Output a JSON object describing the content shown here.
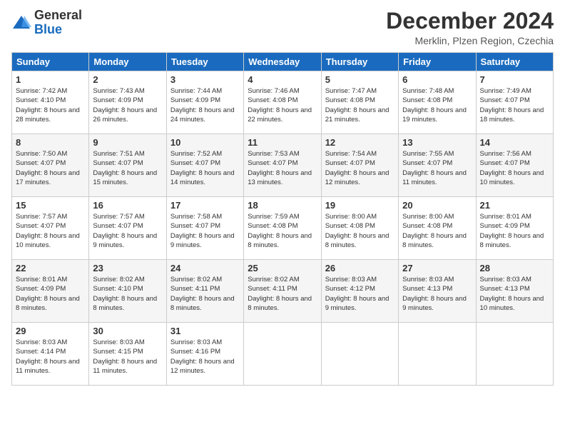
{
  "header": {
    "logo": {
      "line1": "General",
      "line2": "Blue"
    },
    "title": "December 2024",
    "location": "Merklin, Plzen Region, Czechia"
  },
  "weekdays": [
    "Sunday",
    "Monday",
    "Tuesday",
    "Wednesday",
    "Thursday",
    "Friday",
    "Saturday"
  ],
  "weeks": [
    [
      {
        "day": "1",
        "sunrise": "Sunrise: 7:42 AM",
        "sunset": "Sunset: 4:10 PM",
        "daylight": "Daylight: 8 hours and 28 minutes."
      },
      {
        "day": "2",
        "sunrise": "Sunrise: 7:43 AM",
        "sunset": "Sunset: 4:09 PM",
        "daylight": "Daylight: 8 hours and 26 minutes."
      },
      {
        "day": "3",
        "sunrise": "Sunrise: 7:44 AM",
        "sunset": "Sunset: 4:09 PM",
        "daylight": "Daylight: 8 hours and 24 minutes."
      },
      {
        "day": "4",
        "sunrise": "Sunrise: 7:46 AM",
        "sunset": "Sunset: 4:08 PM",
        "daylight": "Daylight: 8 hours and 22 minutes."
      },
      {
        "day": "5",
        "sunrise": "Sunrise: 7:47 AM",
        "sunset": "Sunset: 4:08 PM",
        "daylight": "Daylight: 8 hours and 21 minutes."
      },
      {
        "day": "6",
        "sunrise": "Sunrise: 7:48 AM",
        "sunset": "Sunset: 4:08 PM",
        "daylight": "Daylight: 8 hours and 19 minutes."
      },
      {
        "day": "7",
        "sunrise": "Sunrise: 7:49 AM",
        "sunset": "Sunset: 4:07 PM",
        "daylight": "Daylight: 8 hours and 18 minutes."
      }
    ],
    [
      {
        "day": "8",
        "sunrise": "Sunrise: 7:50 AM",
        "sunset": "Sunset: 4:07 PM",
        "daylight": "Daylight: 8 hours and 17 minutes."
      },
      {
        "day": "9",
        "sunrise": "Sunrise: 7:51 AM",
        "sunset": "Sunset: 4:07 PM",
        "daylight": "Daylight: 8 hours and 15 minutes."
      },
      {
        "day": "10",
        "sunrise": "Sunrise: 7:52 AM",
        "sunset": "Sunset: 4:07 PM",
        "daylight": "Daylight: 8 hours and 14 minutes."
      },
      {
        "day": "11",
        "sunrise": "Sunrise: 7:53 AM",
        "sunset": "Sunset: 4:07 PM",
        "daylight": "Daylight: 8 hours and 13 minutes."
      },
      {
        "day": "12",
        "sunrise": "Sunrise: 7:54 AM",
        "sunset": "Sunset: 4:07 PM",
        "daylight": "Daylight: 8 hours and 12 minutes."
      },
      {
        "day": "13",
        "sunrise": "Sunrise: 7:55 AM",
        "sunset": "Sunset: 4:07 PM",
        "daylight": "Daylight: 8 hours and 11 minutes."
      },
      {
        "day": "14",
        "sunrise": "Sunrise: 7:56 AM",
        "sunset": "Sunset: 4:07 PM",
        "daylight": "Daylight: 8 hours and 10 minutes."
      }
    ],
    [
      {
        "day": "15",
        "sunrise": "Sunrise: 7:57 AM",
        "sunset": "Sunset: 4:07 PM",
        "daylight": "Daylight: 8 hours and 10 minutes."
      },
      {
        "day": "16",
        "sunrise": "Sunrise: 7:57 AM",
        "sunset": "Sunset: 4:07 PM",
        "daylight": "Daylight: 8 hours and 9 minutes."
      },
      {
        "day": "17",
        "sunrise": "Sunrise: 7:58 AM",
        "sunset": "Sunset: 4:07 PM",
        "daylight": "Daylight: 8 hours and 9 minutes."
      },
      {
        "day": "18",
        "sunrise": "Sunrise: 7:59 AM",
        "sunset": "Sunset: 4:08 PM",
        "daylight": "Daylight: 8 hours and 8 minutes."
      },
      {
        "day": "19",
        "sunrise": "Sunrise: 8:00 AM",
        "sunset": "Sunset: 4:08 PM",
        "daylight": "Daylight: 8 hours and 8 minutes."
      },
      {
        "day": "20",
        "sunrise": "Sunrise: 8:00 AM",
        "sunset": "Sunset: 4:08 PM",
        "daylight": "Daylight: 8 hours and 8 minutes."
      },
      {
        "day": "21",
        "sunrise": "Sunrise: 8:01 AM",
        "sunset": "Sunset: 4:09 PM",
        "daylight": "Daylight: 8 hours and 8 minutes."
      }
    ],
    [
      {
        "day": "22",
        "sunrise": "Sunrise: 8:01 AM",
        "sunset": "Sunset: 4:09 PM",
        "daylight": "Daylight: 8 hours and 8 minutes."
      },
      {
        "day": "23",
        "sunrise": "Sunrise: 8:02 AM",
        "sunset": "Sunset: 4:10 PM",
        "daylight": "Daylight: 8 hours and 8 minutes."
      },
      {
        "day": "24",
        "sunrise": "Sunrise: 8:02 AM",
        "sunset": "Sunset: 4:11 PM",
        "daylight": "Daylight: 8 hours and 8 minutes."
      },
      {
        "day": "25",
        "sunrise": "Sunrise: 8:02 AM",
        "sunset": "Sunset: 4:11 PM",
        "daylight": "Daylight: 8 hours and 8 minutes."
      },
      {
        "day": "26",
        "sunrise": "Sunrise: 8:03 AM",
        "sunset": "Sunset: 4:12 PM",
        "daylight": "Daylight: 8 hours and 9 minutes."
      },
      {
        "day": "27",
        "sunrise": "Sunrise: 8:03 AM",
        "sunset": "Sunset: 4:13 PM",
        "daylight": "Daylight: 8 hours and 9 minutes."
      },
      {
        "day": "28",
        "sunrise": "Sunrise: 8:03 AM",
        "sunset": "Sunset: 4:13 PM",
        "daylight": "Daylight: 8 hours and 10 minutes."
      }
    ],
    [
      {
        "day": "29",
        "sunrise": "Sunrise: 8:03 AM",
        "sunset": "Sunset: 4:14 PM",
        "daylight": "Daylight: 8 hours and 11 minutes."
      },
      {
        "day": "30",
        "sunrise": "Sunrise: 8:03 AM",
        "sunset": "Sunset: 4:15 PM",
        "daylight": "Daylight: 8 hours and 11 minutes."
      },
      {
        "day": "31",
        "sunrise": "Sunrise: 8:03 AM",
        "sunset": "Sunset: 4:16 PM",
        "daylight": "Daylight: 8 hours and 12 minutes."
      },
      null,
      null,
      null,
      null
    ]
  ]
}
